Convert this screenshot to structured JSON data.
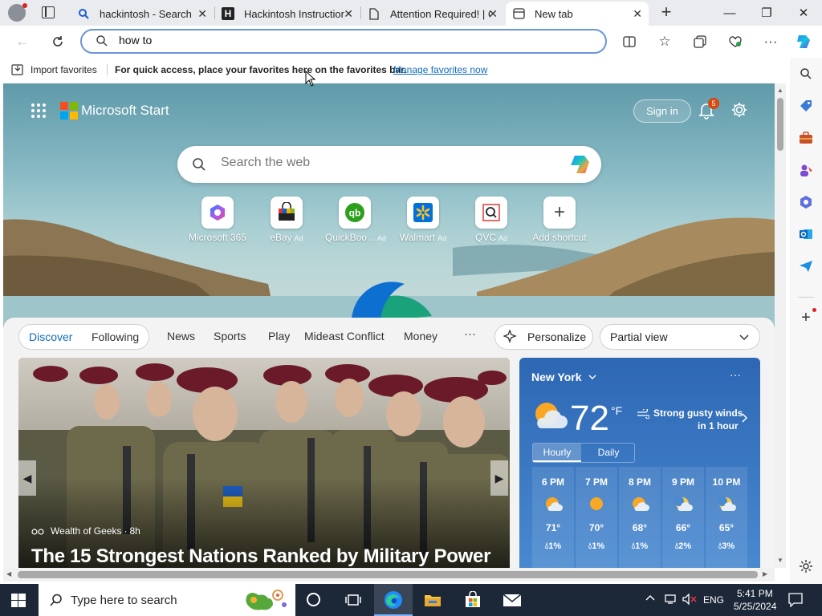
{
  "tabs": [
    {
      "label": "hackintosh - Search",
      "icon": "search-icon"
    },
    {
      "label": "Hackintosh Instructions",
      "icon": "h-site-icon"
    },
    {
      "label": "Attention Required! | Cloudflare",
      "icon": "document-icon"
    },
    {
      "label": "New tab",
      "icon": "new-tab-icon"
    }
  ],
  "address": {
    "value": "how to"
  },
  "favorites": {
    "import_label": "Import favorites",
    "message": "For quick access, place your favorites here on the favorites bar.",
    "manage_link": "Manage favorites now"
  },
  "start": {
    "brand": "Microsoft Start",
    "sign_in": "Sign in",
    "notification_count": "5",
    "search_placeholder": "Search the web"
  },
  "quick_links": [
    {
      "label": "Microsoft 365",
      "ad": ""
    },
    {
      "label": "eBay",
      "ad": "Ad"
    },
    {
      "label": "QuickBoo...",
      "ad": "Ad"
    },
    {
      "label": "Walmart",
      "ad": "Ad"
    },
    {
      "label": "QVC",
      "ad": "Ad"
    },
    {
      "label": "Add shortcut",
      "ad": ""
    }
  ],
  "feed_nav": {
    "items": [
      "Discover",
      "Following",
      "News",
      "Sports",
      "Play",
      "Mideast Conflict",
      "Money"
    ],
    "more": "···",
    "personalize": "Personalize",
    "view_select": "Partial view"
  },
  "article": {
    "source": "Wealth of Geeks",
    "age": "8h",
    "dot": "·",
    "headline": "The 15 Strongest Nations Ranked by Military Power"
  },
  "weather": {
    "city": "New York",
    "temp": "72",
    "unit": "°F",
    "alert_line1": "Strong gusty winds",
    "alert_line2": "in 1 hour",
    "tab_hourly": "Hourly",
    "tab_daily": "Daily",
    "hours": [
      {
        "time": "6 PM",
        "temp": "71°",
        "precip": "1%"
      },
      {
        "time": "7 PM",
        "temp": "70°",
        "precip": "1%"
      },
      {
        "time": "8 PM",
        "temp": "68°",
        "precip": "1%"
      },
      {
        "time": "9 PM",
        "temp": "66°",
        "precip": "2%"
      },
      {
        "time": "10 PM",
        "temp": "65°",
        "precip": "3%"
      }
    ]
  },
  "taskbar": {
    "search_placeholder": "Type here to search",
    "lang": "ENG",
    "time": "5:41 PM",
    "date": "5/25/2024"
  },
  "colors": {
    "accent": "#0f6cbd",
    "omnibox_border": "#6a95d8",
    "weather_bg": "#2d67b4",
    "taskbar_bg": "#1c2738"
  }
}
